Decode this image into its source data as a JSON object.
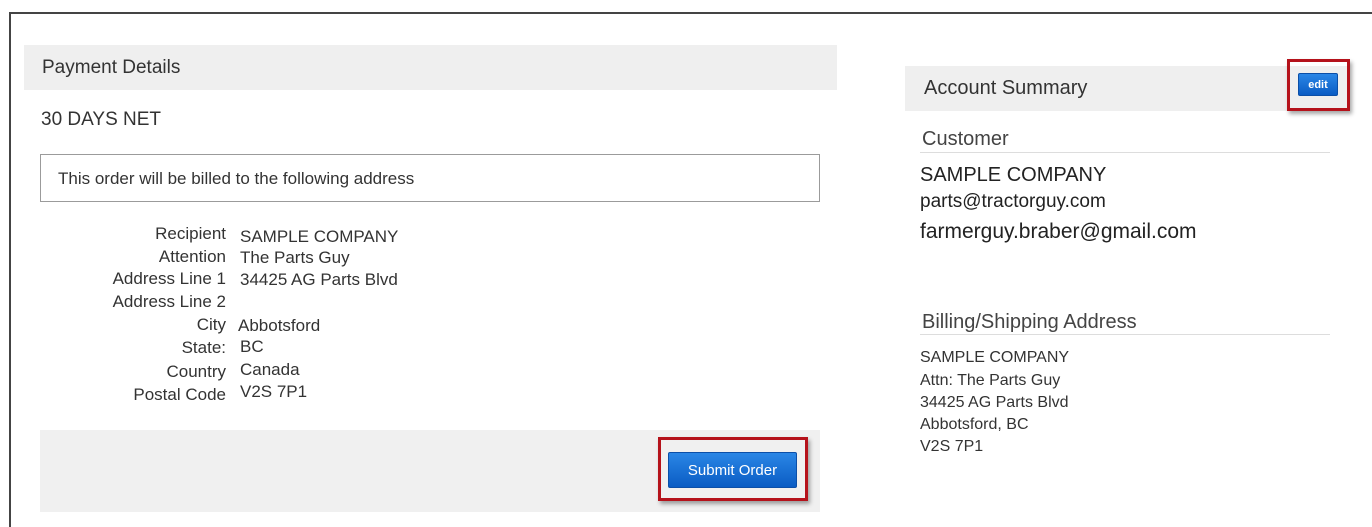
{
  "payment": {
    "header": "Payment Details",
    "terms": "30 DAYS NET",
    "notice": "This order will be billed to the following address",
    "address": [
      {
        "label": "Recipient",
        "value": "SAMPLE COMPANY"
      },
      {
        "label": "Attention",
        "value": "The Parts Guy"
      },
      {
        "label": "Address Line 1",
        "value": "34425 AG Parts Blvd"
      },
      {
        "label": "Address Line 2",
        "value": ""
      },
      {
        "label": "City",
        "value": "Abbotsford"
      },
      {
        "label": "State:",
        "value": "BC"
      },
      {
        "label": "Country",
        "value": "Canada"
      },
      {
        "label": "Postal Code",
        "value": "V2S 7P1"
      }
    ],
    "submit_label": "Submit Order"
  },
  "account": {
    "header": "Account Summary",
    "edit_label": "edit",
    "customer_title": "Customer",
    "customer_name": "SAMPLE COMPANY",
    "customer_email_1": "parts@tractorguy.com",
    "customer_email_2": "farmerguy.braber@gmail.com",
    "billing_title": "Billing/Shipping Address",
    "billing_lines": [
      "SAMPLE COMPANY",
      "Attn: The Parts Guy",
      "34425 AG Parts Blvd",
      "Abbotsford, BC",
      "V2S 7P1"
    ]
  },
  "colors": {
    "highlight": "#b5121b",
    "button": "#0a5cc4",
    "panel": "#efefef"
  }
}
